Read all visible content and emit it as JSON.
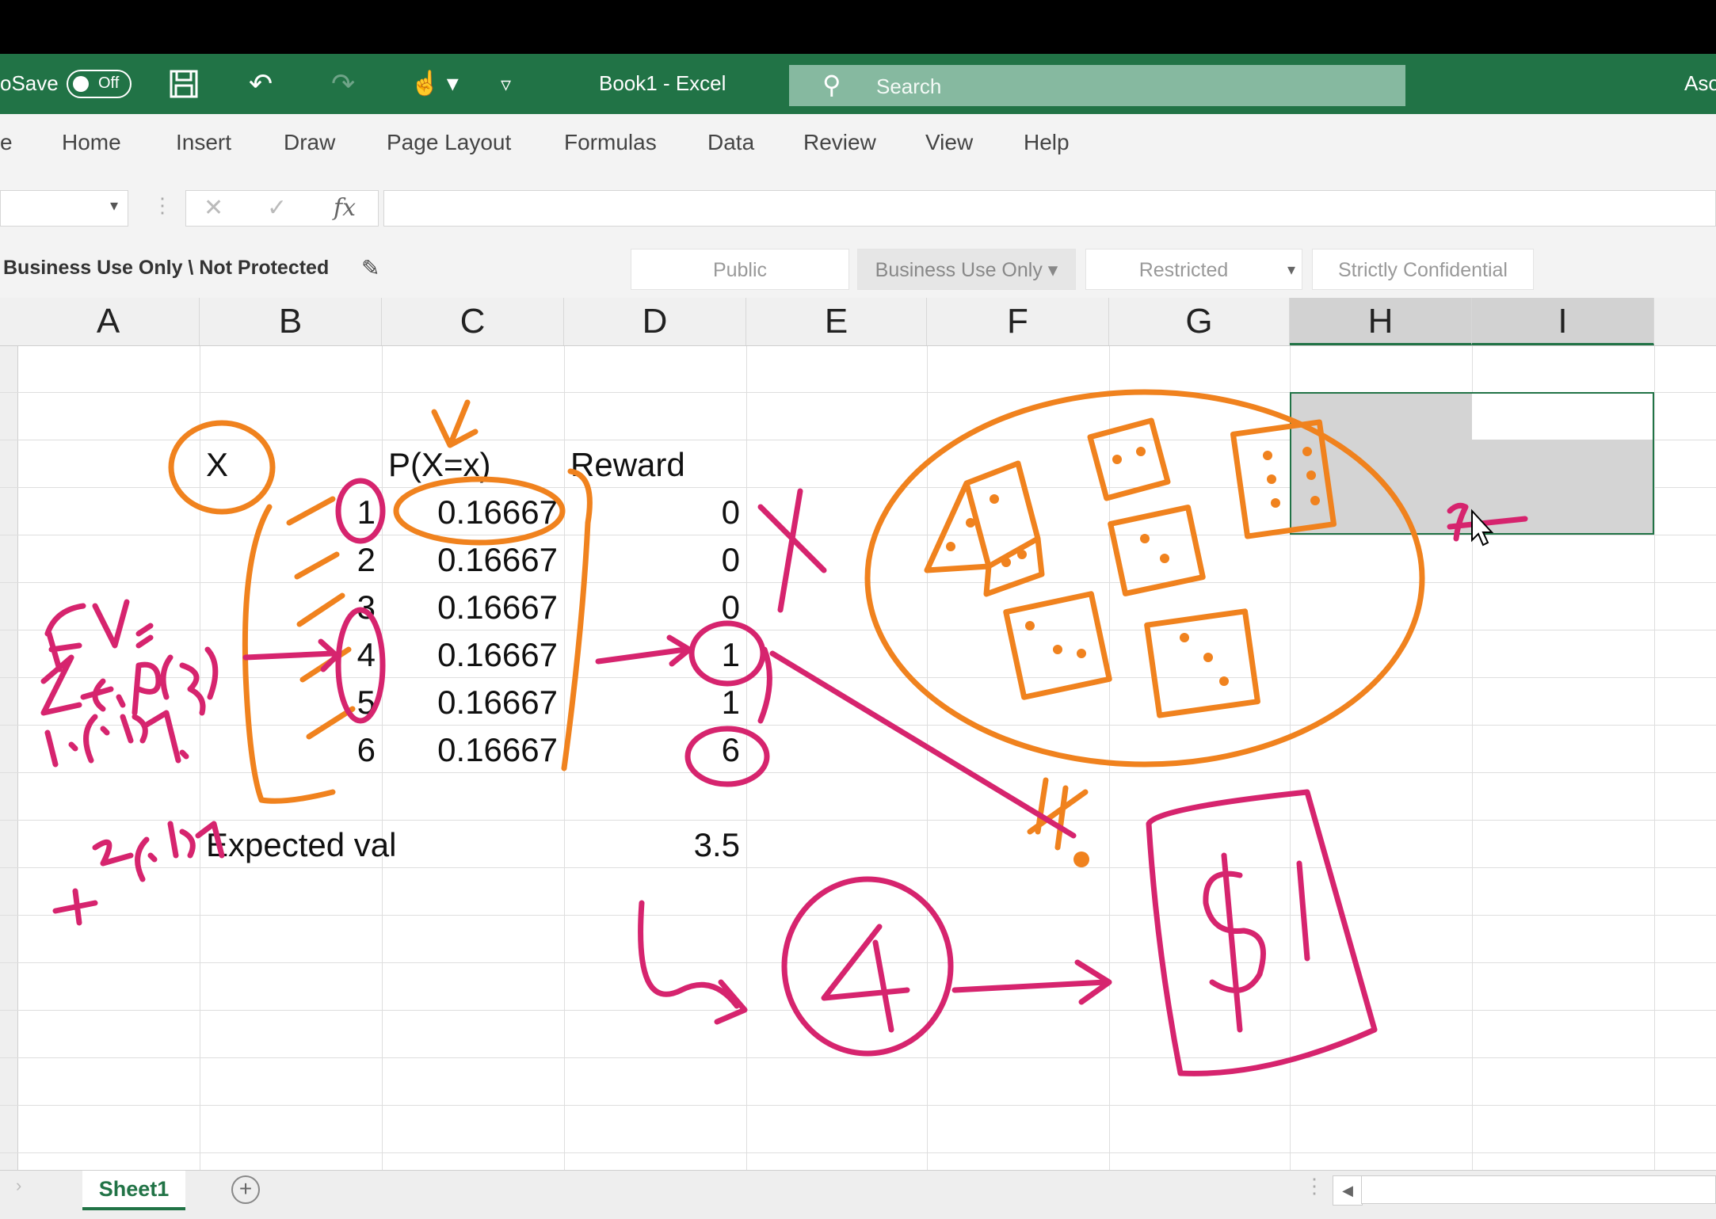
{
  "titlebar": {
    "autosave_label": "oSave",
    "toggle_state": "Off",
    "doc_title": "Book1  -  Excel",
    "search_placeholder": "Search",
    "account": "Aso"
  },
  "menu": [
    "e",
    "Home",
    "Insert",
    "Draw",
    "Page Layout",
    "Formulas",
    "Data",
    "Review",
    "View",
    "Help"
  ],
  "formula_bar": {
    "fx": "fx",
    "cancel": "✕",
    "enter": "✓",
    "dropdown": "▾"
  },
  "labels": {
    "status": "Business Use Only \\ Not Protected",
    "buttons": [
      "Public",
      "Business Use Only ▾",
      "Restricted",
      "Strictly Confidential"
    ],
    "restricted_arrow": "▾"
  },
  "columns": [
    "A",
    "B",
    "C",
    "D",
    "E",
    "F",
    "G",
    "H",
    "I"
  ],
  "table": {
    "header_x": "X",
    "header_p": "P(X=x)",
    "header_reward": "Reward",
    "rows": [
      {
        "x": "1",
        "p": "0.16667",
        "reward": "0"
      },
      {
        "x": "2",
        "p": "0.16667",
        "reward": "0"
      },
      {
        "x": "3",
        "p": "0.16667",
        "reward": "0"
      },
      {
        "x": "4",
        "p": "0.16667",
        "reward": "1"
      },
      {
        "x": "5",
        "p": "0.16667",
        "reward": "1"
      },
      {
        "x": "6",
        "p": "0.16667",
        "reward": "6"
      }
    ],
    "expected_label": "Expected val",
    "expected_value": "3.5"
  },
  "sheet": {
    "tab": "Sheet1",
    "add": "+"
  },
  "colors": {
    "excel_green": "#217346",
    "ink_orange": "#f0821e",
    "ink_magenta": "#d6246e"
  },
  "icons": [
    "save-icon",
    "undo-icon",
    "redo-icon",
    "touch-mode-icon",
    "customize-qat-icon",
    "search-icon",
    "pencil-icon",
    "add-sheet-icon"
  ]
}
